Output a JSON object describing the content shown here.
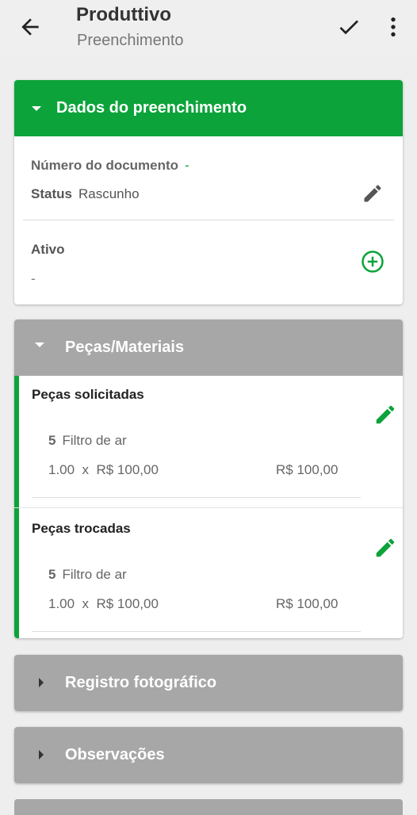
{
  "appbar": {
    "title": "Produttivo",
    "subtitle": "Preenchimento",
    "back_icon": "arrow-left-icon",
    "confirm_icon": "check-icon",
    "menu_icon": "more-vert-icon"
  },
  "colors": {
    "accent": "#0ca33a",
    "collapsed_header": "#a7a7a7",
    "background": "#eeeeee"
  },
  "fill_data": {
    "header": "Dados do preenchimento",
    "document_number_label": "Número do documento",
    "document_number_value": "-",
    "status_label": "Status",
    "status_value": "Rascunho",
    "asset_label": "Ativo",
    "asset_value": "-"
  },
  "parts": {
    "header": "Peças/Materiais",
    "sections": [
      {
        "title": "Peças solicitadas",
        "qty_code": "5",
        "item_name": "Filtro de ar",
        "line": "1.00  x  R$ 100,00",
        "total": "R$ 100,00"
      },
      {
        "title": "Peças trocadas",
        "qty_code": "5",
        "item_name": "Filtro de ar",
        "line": "1.00  x  R$ 100,00",
        "total": "R$ 100,00"
      }
    ]
  },
  "photo_section": {
    "header": "Registro fotográfico"
  },
  "notes_section": {
    "header": "Observações"
  }
}
